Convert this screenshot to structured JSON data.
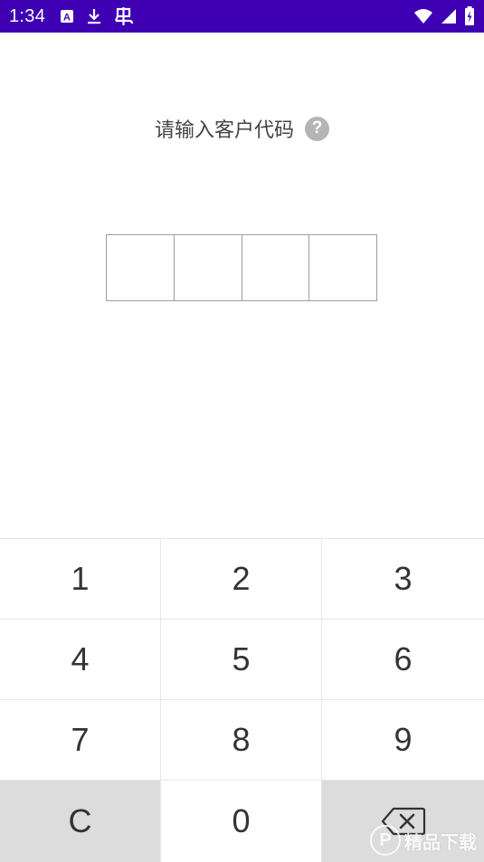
{
  "status_bar": {
    "time": "1:34",
    "bg_color": "#3f00b4",
    "left_icons": [
      "text-a-icon",
      "download-icon",
      "bug-icon"
    ],
    "right_icons": [
      "wifi-icon",
      "cell-signal-icon",
      "battery-icon"
    ]
  },
  "prompt": {
    "title": "请输入客户代码",
    "help_glyph": "?"
  },
  "code_input": {
    "boxes": [
      "",
      "",
      "",
      ""
    ]
  },
  "keypad": {
    "keys": [
      "1",
      "2",
      "3",
      "4",
      "5",
      "6",
      "7",
      "8",
      "9",
      "C",
      "0"
    ],
    "backspace_icon": "backspace-icon"
  },
  "watermark": {
    "logo": "P",
    "text": "精品下载"
  }
}
